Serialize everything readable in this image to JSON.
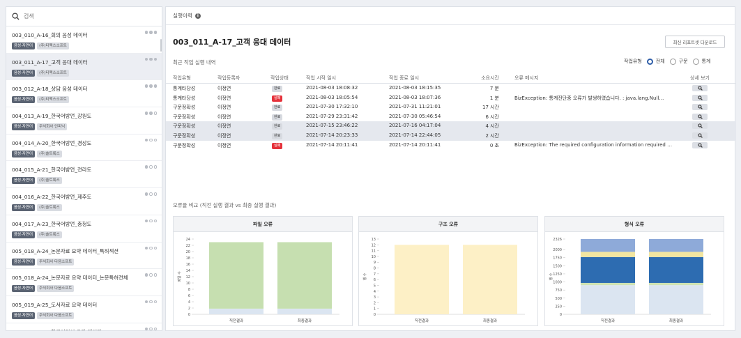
{
  "sidebar": {
    "search_placeholder": "검색",
    "items": [
      {
        "title": "003_010_A-16_회의 음성 데이터",
        "tag1": "음성·자연어",
        "tag2": "(주)티맥스소프트",
        "dots": 3
      },
      {
        "title": "003_011_A-17_고객 응대 데이터",
        "tag1": "음성·자연어",
        "tag2": "(주)티맥스소프트",
        "dots": 3
      },
      {
        "title": "003_012_A-18_상담 음성 데이터",
        "tag1": "음성·자연어",
        "tag2": "(주)티맥스소프트",
        "dots": 3
      },
      {
        "title": "004_013_A-19_한국어방언_강원도",
        "tag1": "음성·자연어",
        "tag2": "주식회사 인피닉",
        "dots": 2
      },
      {
        "title": "004_014_A-20_한국어방언_경상도",
        "tag1": "음성·자연어",
        "tag2": "(주)솔트룩스",
        "dots": 1
      },
      {
        "title": "004_015_A-21_한국어방언_전라도",
        "tag1": "음성·자연어",
        "tag2": "(주)솔트룩스",
        "dots": 1
      },
      {
        "title": "004_016_A-22_한국어방언_제주도",
        "tag1": "음성·자연어",
        "tag2": "(주)솔트룩스",
        "dots": 1
      },
      {
        "title": "004_017_A-23_한국어방언_충청도",
        "tag1": "음성·자연어",
        "tag2": "(주)솔트룩스",
        "dots": 1
      },
      {
        "title": "005_018_A-24_논문자료 요약 데이터_특허섹션",
        "tag1": "음성·자연어",
        "tag2": "주식회사 다음소프트",
        "dots": 1
      },
      {
        "title": "005_018_A-24_논문자료 요약 데이터_논문특허전체",
        "tag1": "음성·자연어",
        "tag2": "주식회사 다음소프트",
        "dots": 1
      },
      {
        "title": "005_019_A-25_도서자료 요약 데이터",
        "tag1": "음성·자연어",
        "tag2": "주식회사 다음소프트",
        "dots": 1
      },
      {
        "title": "005_020_A-26_한국어연어 요약 데이터",
        "tag1": "음성·자연어",
        "tag2": "주식회사 다음소프트",
        "dots": 1
      }
    ]
  },
  "main": {
    "header": "실행이력",
    "info_icon": "i",
    "dataset_title": "003_011_A-17_고객 응대 데이터",
    "download_button": "최신 리포트셋 다운로드",
    "recent_label": "최근 작업 실행 내역",
    "filter": {
      "label": "작업유형",
      "options": [
        "전체",
        "구문",
        "통계"
      ],
      "selected": "전체"
    },
    "columns": [
      "작업유형",
      "작업등록자",
      "작업상태",
      "작업 시작 일시",
      "작업 종료 일시",
      "소요시간",
      "오류 메시지",
      "상세 보기"
    ],
    "rows": [
      {
        "type": "통계타당성",
        "user": "이정연",
        "status": "완료",
        "status_kind": "ok",
        "start": "2021-08-03 18:08:32",
        "end": "2021-08-03 18:15:35",
        "dur": "7 분",
        "err": ""
      },
      {
        "type": "통계타당성",
        "user": "이정연",
        "status": "실패",
        "status_kind": "fail",
        "start": "2021-08-03 18:05:54",
        "end": "2021-08-03 18:07:36",
        "dur": "1 분",
        "err": "BizException: 통계진단중 오류가 발생하였습니다. : java.lang.Null…"
      },
      {
        "type": "구문정확성",
        "user": "이정연",
        "status": "완료",
        "status_kind": "ok",
        "start": "2021-07-30 17:32:10",
        "end": "2021-07-31 11:21:01",
        "dur": "17 시간",
        "err": ""
      },
      {
        "type": "구문정확성",
        "user": "이정연",
        "status": "완료",
        "status_kind": "ok",
        "start": "2021-07-29 23:31:42",
        "end": "2021-07-30 05:46:54",
        "dur": "6 시간",
        "err": ""
      },
      {
        "type": "구문정확성",
        "user": "이정연",
        "status": "완료",
        "status_kind": "ok",
        "start": "2021-07-15 23:46:22",
        "end": "2021-07-16 04:17:04",
        "dur": "4 시간",
        "err": ""
      },
      {
        "type": "구문정확성",
        "user": "이정연",
        "status": "완료",
        "status_kind": "ok",
        "start": "2021-07-14 20:23:33",
        "end": "2021-07-14 22:44:05",
        "dur": "2 시간",
        "err": ""
      },
      {
        "type": "구문정확성",
        "user": "이정연",
        "status": "실패",
        "status_kind": "fail",
        "start": "2021-07-14 20:11:41",
        "end": "2021-07-14 20:11:41",
        "dur": "0 초",
        "err": "BizException: The required configuration information required …"
      }
    ],
    "highlighted_rows": [
      4,
      5
    ],
    "compare_label": "오류율 비교 (직전 실행 결과 vs 최종 실행 결과)"
  },
  "chart_data": [
    {
      "type": "bar",
      "title": "파일 오류",
      "ylabel": "파일 수",
      "categories": [
        "직전결과",
        "최종결과"
      ],
      "yticks": [
        0,
        2,
        4,
        6,
        8,
        10,
        12,
        14,
        16,
        18,
        20,
        22,
        24
      ],
      "ylim": [
        0,
        24
      ],
      "series": [
        {
          "color": "#dbe5f1",
          "values": [
            1.8,
            1.8
          ]
        },
        {
          "color": "#c6dfb0",
          "values": [
            21.2,
            21.2
          ]
        }
      ]
    },
    {
      "type": "bar",
      "title": "구조 오류",
      "ylabel": "행 수",
      "categories": [
        "직전결과",
        "최종결과"
      ],
      "yticks": [
        0,
        1,
        2,
        3,
        4,
        5,
        6,
        7,
        8,
        9,
        10,
        11,
        12,
        13
      ],
      "ylim": [
        0,
        13
      ],
      "series": [
        {
          "color": "#fdf0c6",
          "values": [
            12,
            12
          ]
        }
      ]
    },
    {
      "type": "bar",
      "title": "형식 오류",
      "ylabel": "행 수",
      "categories": [
        "직전결과",
        "최종결과"
      ],
      "yticks": [
        0,
        250,
        500,
        750,
        1000,
        1250,
        1500,
        1750,
        2000,
        2326
      ],
      "ylim": [
        0,
        2326
      ],
      "series": [
        {
          "color": "#dbe5f1",
          "values": [
            900,
            900
          ]
        },
        {
          "color": "#cfe3b4",
          "values": [
            70,
            70
          ]
        },
        {
          "color": "#2d6cb1",
          "values": [
            800,
            800
          ]
        },
        {
          "color": "#f2e6a0",
          "values": [
            160,
            160
          ]
        },
        {
          "color": "#8eaad9",
          "values": [
            396,
            396
          ]
        }
      ]
    }
  ]
}
